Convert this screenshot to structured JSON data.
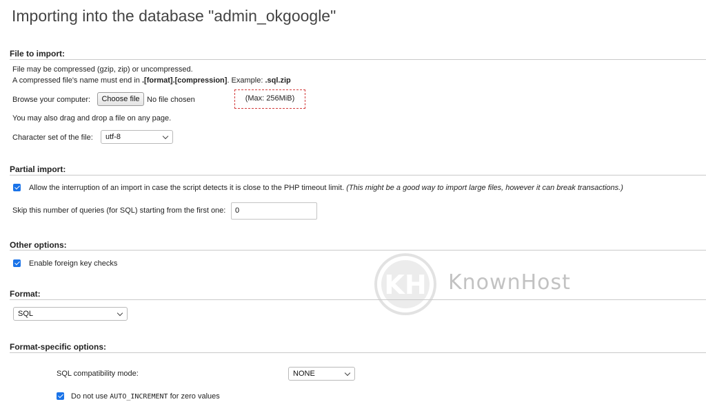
{
  "page": {
    "title": "Importing into the database \"admin_okgoogle\""
  },
  "file_to_import": {
    "heading": "File to import:",
    "compress_note": "File may be compressed (gzip, zip) or uncompressed.",
    "name_note_prefix": "A compressed file's name must end in ",
    "name_note_format": ".[format].[compression]",
    "name_note_example_label": ". Example: ",
    "name_note_example": ".sql.zip",
    "browse_label": "Browse your computer:",
    "choose_file_button": "Choose file",
    "no_file_text": "No file chosen",
    "max_size": "(Max: 256MiB)",
    "drag_drop_note": "You may also drag and drop a file on any page.",
    "charset_label": "Character set of the file:",
    "charset_value": "utf-8"
  },
  "partial_import": {
    "heading": "Partial import:",
    "allow_interrupt_checked": true,
    "allow_interrupt_label": "Allow the interruption of an import in case the script detects it is close to the PHP timeout limit.",
    "allow_interrupt_note": "(This might be a good way to import large files, however it can break transactions.)",
    "skip_label": "Skip this number of queries (for SQL) starting from the first one:",
    "skip_value": "0"
  },
  "other_options": {
    "heading": "Other options:",
    "foreign_key_checked": true,
    "foreign_key_label": "Enable foreign key checks"
  },
  "format": {
    "heading": "Format:",
    "value": "SQL"
  },
  "format_specific": {
    "heading": "Format-specific options:",
    "compat_label": "SQL compatibility mode:",
    "compat_value": "NONE",
    "auto_increment_checked": true,
    "auto_increment_prefix": "Do not use ",
    "auto_increment_code": "AUTO_INCREMENT",
    "auto_increment_suffix": " for zero values"
  },
  "watermark": {
    "text": "KnownHost",
    "logo": "kh-circle-logo"
  },
  "colors": {
    "accent": "#1a73e8",
    "highlight_border": "#d23a3a"
  }
}
